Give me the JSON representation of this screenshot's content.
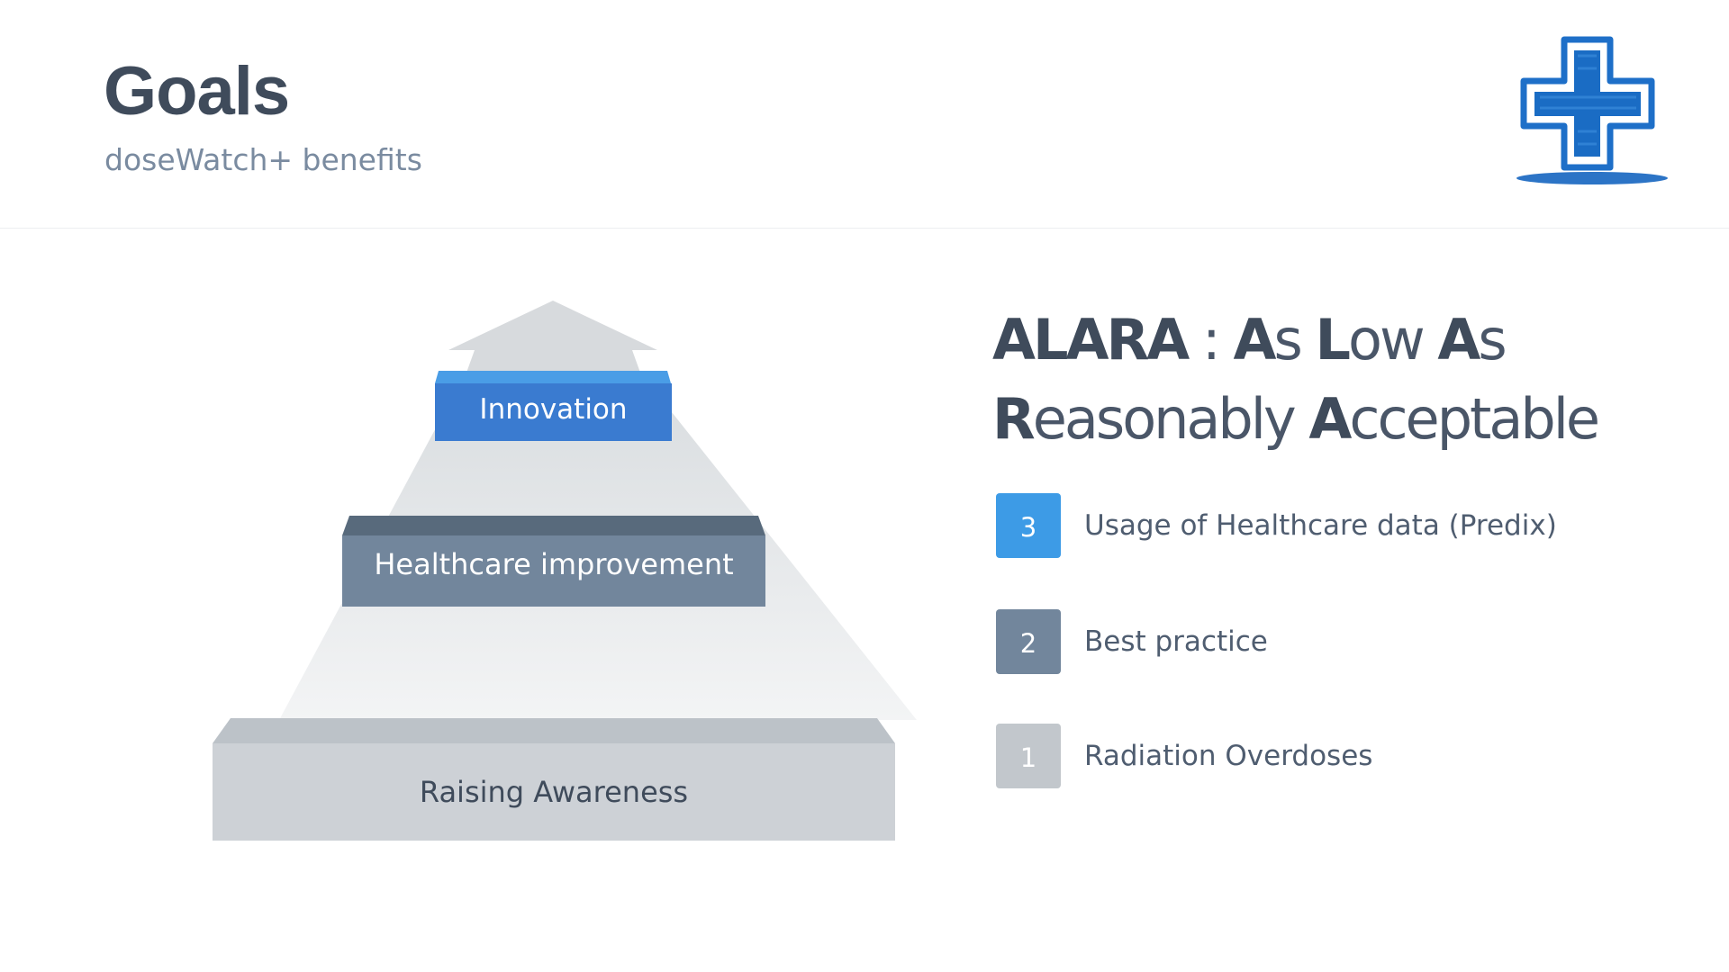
{
  "header": {
    "title": "Goals",
    "subtitle": "doseWatch+ benefits",
    "logo_icon": "medical-cross-icon"
  },
  "pyramid": {
    "steps": [
      {
        "label": "Innovation",
        "color": "#3a7bd0",
        "top_color": "#4a9de6"
      },
      {
        "label": "Healthcare improvement",
        "color": "#72869c",
        "top_color": "#586a7c"
      },
      {
        "label": "Raising Awareness",
        "color": "#cdd1d6",
        "top_color": "#bcc2c8"
      }
    ],
    "arrow_color": "#d5d9dd"
  },
  "alara": {
    "line1": [
      {
        "text": "ALARA",
        "style": "strong"
      },
      {
        "text": " : ",
        "style": "light"
      },
      {
        "text": "A",
        "style": "strong"
      },
      {
        "text": "s ",
        "style": "light"
      },
      {
        "text": "L",
        "style": "strong"
      },
      {
        "text": "ow ",
        "style": "light"
      },
      {
        "text": "A",
        "style": "strong"
      },
      {
        "text": "s",
        "style": "light"
      }
    ],
    "line2": [
      {
        "text": "R",
        "style": "strong"
      },
      {
        "text": "easonably ",
        "style": "light"
      },
      {
        "text": "A",
        "style": "strong"
      },
      {
        "text": "cceptable",
        "style": "light"
      }
    ]
  },
  "legend": [
    {
      "number": "3",
      "text": "Usage of Healthcare data (Predix)",
      "color": "#3d9be6"
    },
    {
      "number": "2",
      "text": "Best practice",
      "color": "#72869c"
    },
    {
      "number": "1",
      "text": "Radiation Overdoses",
      "color": "#c2c7cc"
    }
  ]
}
